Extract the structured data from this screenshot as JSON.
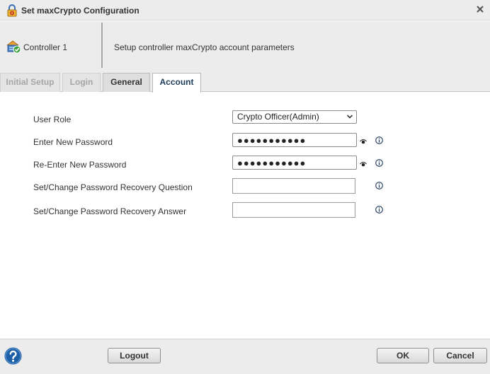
{
  "window": {
    "title": "Set maxCrypto Configuration",
    "close_icon": "close-icon",
    "title_icon": "lock-gear-icon"
  },
  "header": {
    "controller_label": "Controller 1",
    "controller_icon": "controller-check-icon",
    "description": "Setup controller maxCrypto account parameters"
  },
  "tabs": [
    {
      "label": "Initial Setup",
      "state": "disabled"
    },
    {
      "label": "Login",
      "state": "disabled"
    },
    {
      "label": "General",
      "state": "inactive"
    },
    {
      "label": "Account",
      "state": "active"
    }
  ],
  "form": {
    "user_role": {
      "label": "User Role",
      "value": "Crypto Officer(Admin)"
    },
    "new_password": {
      "label": "Enter New Password",
      "value": "●●●●●●●●●●●"
    },
    "reenter_password": {
      "label": "Re-Enter New Password",
      "value": "●●●●●●●●●●●"
    },
    "recovery_question": {
      "label": "Set/Change Password Recovery Question",
      "value": ""
    },
    "recovery_answer": {
      "label": "Set/Change Password Recovery Answer",
      "value": ""
    }
  },
  "footer": {
    "logout_label": "Logout",
    "ok_label": "OK",
    "cancel_label": "Cancel",
    "help_icon": "help-icon"
  },
  "colors": {
    "accent": "#1f3b5a",
    "help_blue": "#1d5fa6",
    "panel_bg": "#ececec"
  }
}
